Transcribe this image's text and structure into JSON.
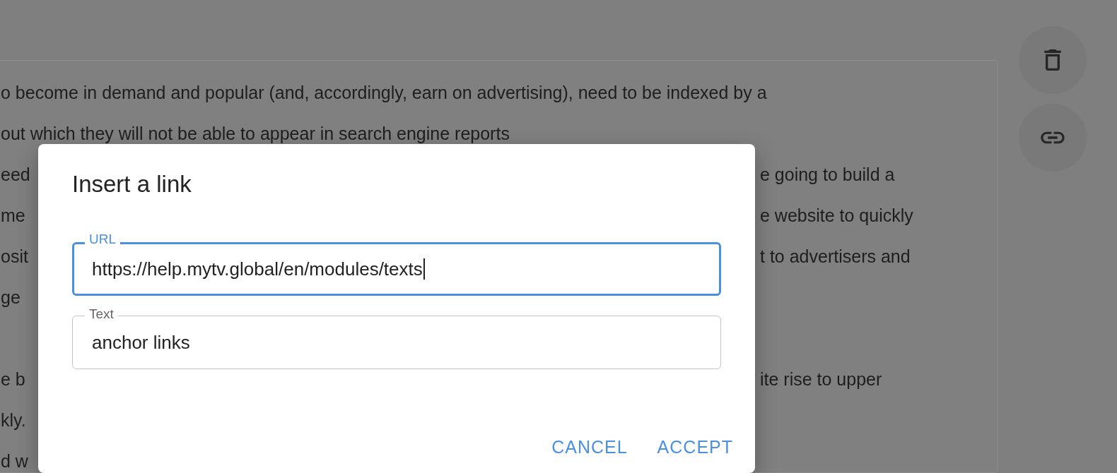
{
  "editor": {
    "lines": [
      {
        "kind": "text",
        "left": "o become in demand and popular (and, accordingly, earn on advertising), need to be indexed by a"
      },
      {
        "kind": "text",
        "left": "out which they will not be able to appear in search engine reports"
      },
      {
        "kind": "text",
        "left": "eed",
        "right": "e going to build a"
      },
      {
        "kind": "text",
        "left": "me",
        "right": "e website to quickly"
      },
      {
        "kind": "text",
        "left": "osit",
        "right": "t to advertisers and"
      },
      {
        "kind": "text",
        "left": "ge"
      },
      {
        "kind": "gap"
      },
      {
        "kind": "text",
        "left": "e b",
        "right": "ite rise to upper"
      },
      {
        "kind": "text",
        "left": "kly."
      },
      {
        "kind": "text",
        "left": "d w"
      }
    ]
  },
  "toolbar": [
    {
      "kind": "delete"
    },
    {
      "kind": "link"
    }
  ],
  "dialog": {
    "title": "Insert a link",
    "fields": [
      {
        "label": "URL",
        "value": "https://help.mytv.global/en/modules/texts",
        "focused": true
      },
      {
        "label": "Text",
        "value": "anchor links",
        "focused": false
      }
    ],
    "buttons": [
      "CANCEL",
      "ACCEPT"
    ]
  }
}
